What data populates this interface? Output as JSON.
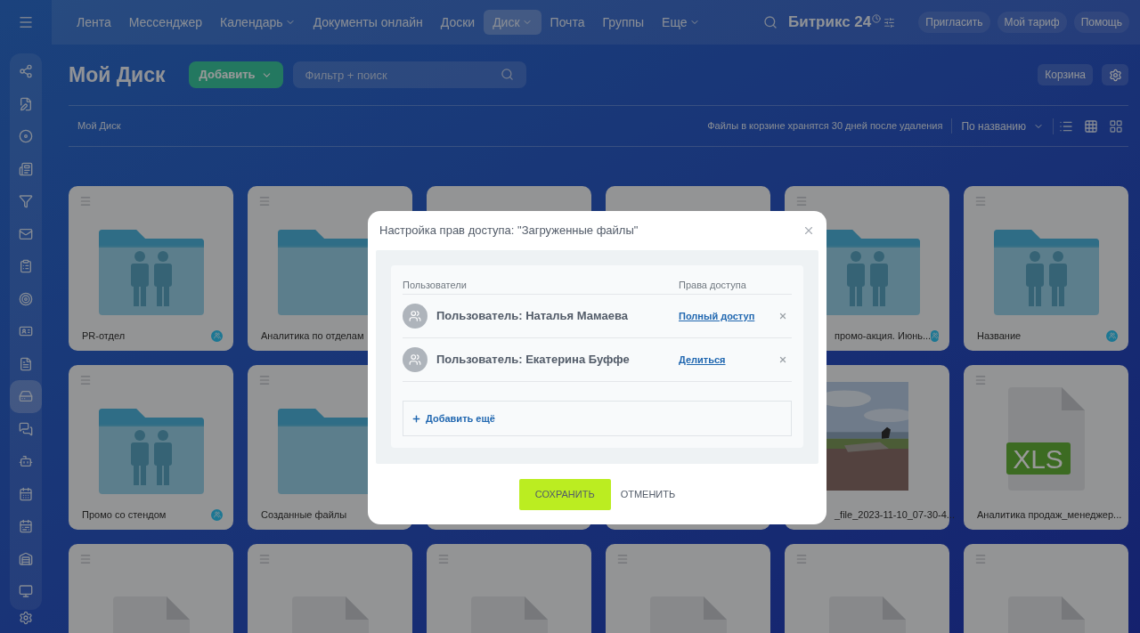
{
  "topbar": {
    "nav": [
      {
        "label": "Лента",
        "selected": false,
        "has_menu": false
      },
      {
        "label": "Мессенджер",
        "selected": false,
        "has_menu": false
      },
      {
        "label": "Календарь",
        "selected": false,
        "has_menu": true
      },
      {
        "label": "Документы онлайн",
        "selected": false,
        "has_menu": false
      },
      {
        "label": "Доски",
        "selected": false,
        "has_menu": false
      },
      {
        "label": "Диск",
        "selected": true,
        "has_menu": true
      },
      {
        "label": "Почта",
        "selected": false,
        "has_menu": false
      },
      {
        "label": "Группы",
        "selected": false,
        "has_menu": false
      },
      {
        "label": "Еще",
        "selected": false,
        "has_menu": true
      }
    ],
    "logo": "Битрикс 24",
    "buttons": [
      "Пригласить",
      "Мой тариф",
      "Помощь"
    ]
  },
  "sidebar": {
    "items": [
      {
        "selected": false
      },
      {
        "selected": false
      },
      {
        "selected": false
      },
      {
        "selected": false
      },
      {
        "selected": false
      },
      {
        "selected": false
      },
      {
        "selected": false
      },
      {
        "selected": false
      },
      {
        "selected": false
      },
      {
        "selected": false
      },
      {
        "selected": true
      },
      {
        "selected": false
      },
      {
        "selected": false
      },
      {
        "selected": false
      },
      {
        "selected": false
      },
      {
        "selected": false
      },
      {
        "selected": false
      }
    ]
  },
  "header": {
    "title": "Мой Диск",
    "add_button": "Добавить",
    "search": {
      "placeholder": "Фильтр + поиск"
    },
    "trash_button": "Корзина"
  },
  "toolbar": {
    "breadcrumb": "Мой Диск",
    "note": "Файлы в корзине хранятся 30 дней после удаления",
    "sort": "По названию"
  },
  "files": [
    {
      "kind": "folder-shared",
      "label": "PR-отдел",
      "clipped": false
    },
    {
      "kind": "folder",
      "label": "Аналитика по отделам",
      "clipped": false
    },
    {
      "kind": "hidden"
    },
    {
      "kind": "hidden"
    },
    {
      "kind": "folder-shared",
      "label": "промо-акция. Июнь...",
      "clipped": true
    },
    {
      "kind": "folder-shared",
      "label": "Название",
      "clipped": false
    },
    {
      "kind": "folder-shared",
      "label": "Промо со стендом",
      "clipped": false
    },
    {
      "kind": "folder",
      "label": "Созданные файлы",
      "clipped": false
    },
    {
      "kind": "hidden"
    },
    {
      "kind": "hidden"
    },
    {
      "label": "_file_2023-11-10_07-30-4...",
      "clipped": true
    },
    {
      "kind": "xls",
      "label": "Аналитика продаж_менеджер...",
      "badge": "XLS",
      "clipped": false
    },
    {
      "kind": "doc"
    },
    {
      "kind": "doc"
    },
    {
      "kind": "doc"
    },
    {
      "kind": "doc"
    },
    {
      "kind": "board"
    },
    {
      "kind": "xls-cut"
    }
  ],
  "dialog": {
    "title": "Настройка прав доступа: \"Загруженные файлы\"",
    "columns": [
      "Пользователи",
      "Права доступа"
    ],
    "rows": [
      {
        "user": "Пользователь: Наталья Мамаева",
        "access": "Полный доступ"
      },
      {
        "user": "Пользователь: Екатерина Буффе",
        "access": "Делиться"
      }
    ],
    "add_more": "Добавить ещё",
    "save": "СОХРАНИТЬ",
    "cancel": "ОТМЕНИТЬ"
  }
}
